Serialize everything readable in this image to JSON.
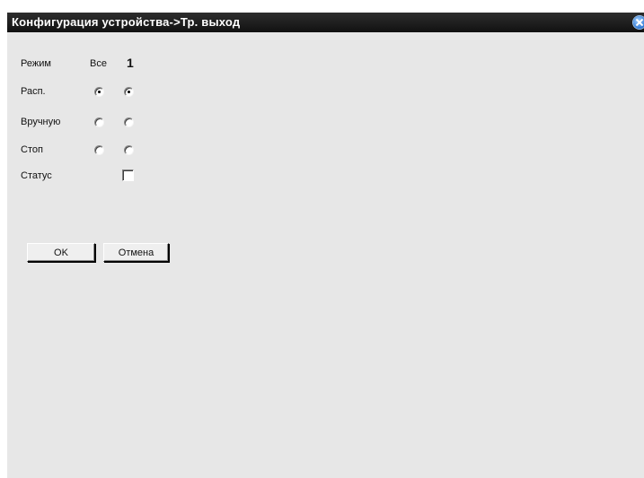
{
  "window": {
    "title": "Конфигурация устройства->Тр. выход"
  },
  "header": {
    "mode_label": "Режим",
    "all_label": "Все",
    "channel_label": "1"
  },
  "rows": [
    {
      "label": "Расп.",
      "all_checked": true,
      "ch1_checked": true
    },
    {
      "label": "Вручную",
      "all_checked": false,
      "ch1_checked": false
    },
    {
      "label": "Стоп",
      "all_checked": false,
      "ch1_checked": false
    }
  ],
  "status": {
    "label": "Статус",
    "checked": false
  },
  "buttons": {
    "ok_label": "OK",
    "cancel_label": "Отмена"
  }
}
